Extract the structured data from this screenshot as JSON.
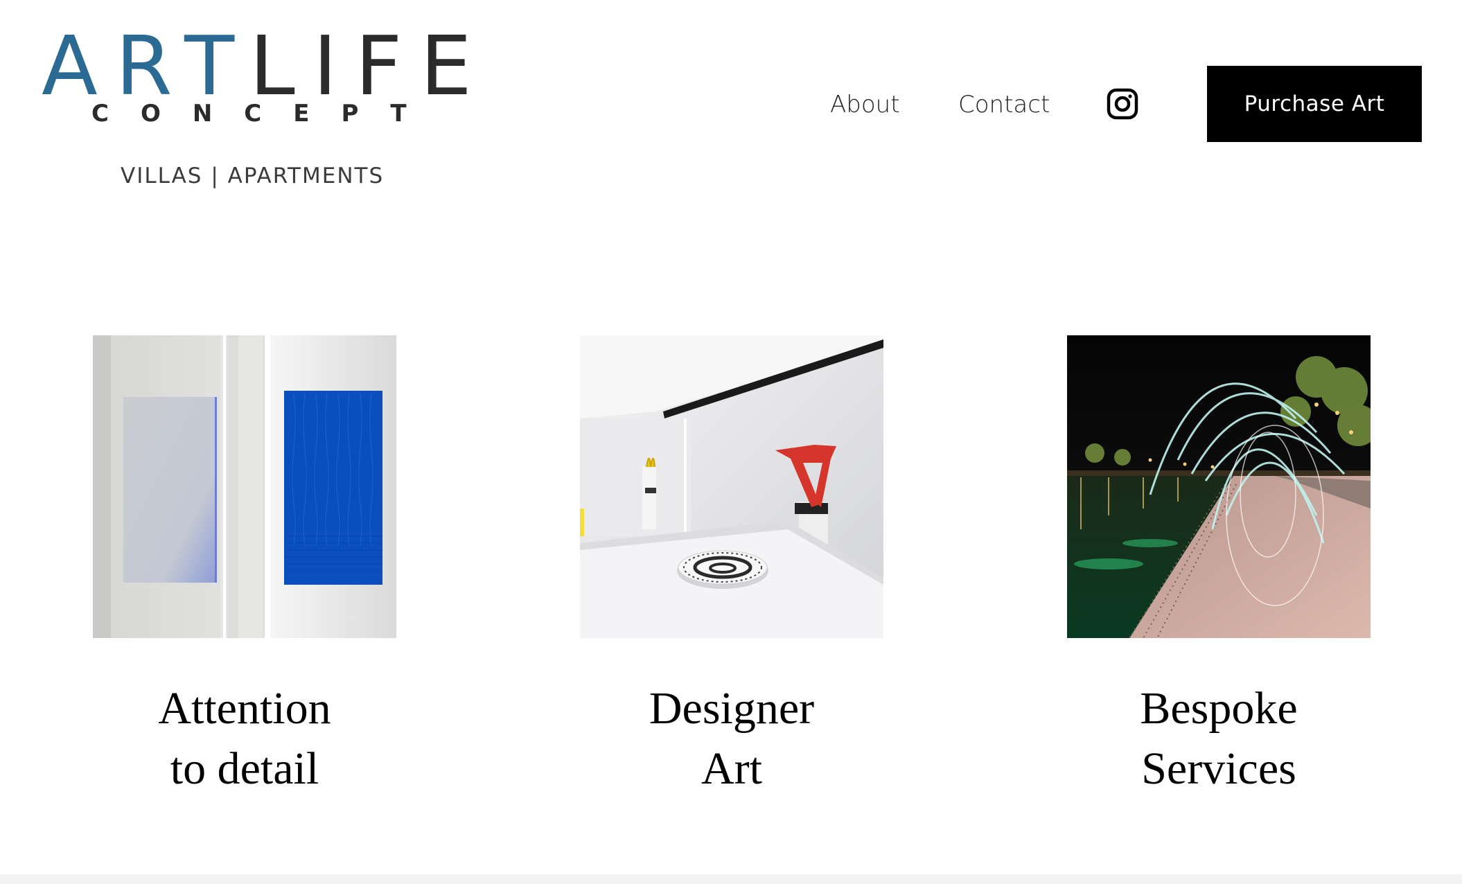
{
  "brand": {
    "logo_part_1": "ART",
    "logo_part_2": "LIFE",
    "logo_sub": "CONCEPT",
    "tagline": "VILLAS | APARTMENTS",
    "colors": {
      "blue": "#2a6a93",
      "dark": "#2b2b2b"
    }
  },
  "nav": {
    "about": "About",
    "contact": "Contact",
    "instagram_icon": "instagram-icon",
    "purchase_button": "Purchase Art"
  },
  "features": [
    {
      "title_line_1": "Attention",
      "title_line_2": "to detail",
      "image": "hallway-blue-artwork"
    },
    {
      "title_line_1": "Designer",
      "title_line_2": "Art",
      "image": "white-kitchen-sculpture"
    },
    {
      "title_line_1": "Bespoke",
      "title_line_2": "Services",
      "image": "night-promenade-light-trails"
    }
  ]
}
